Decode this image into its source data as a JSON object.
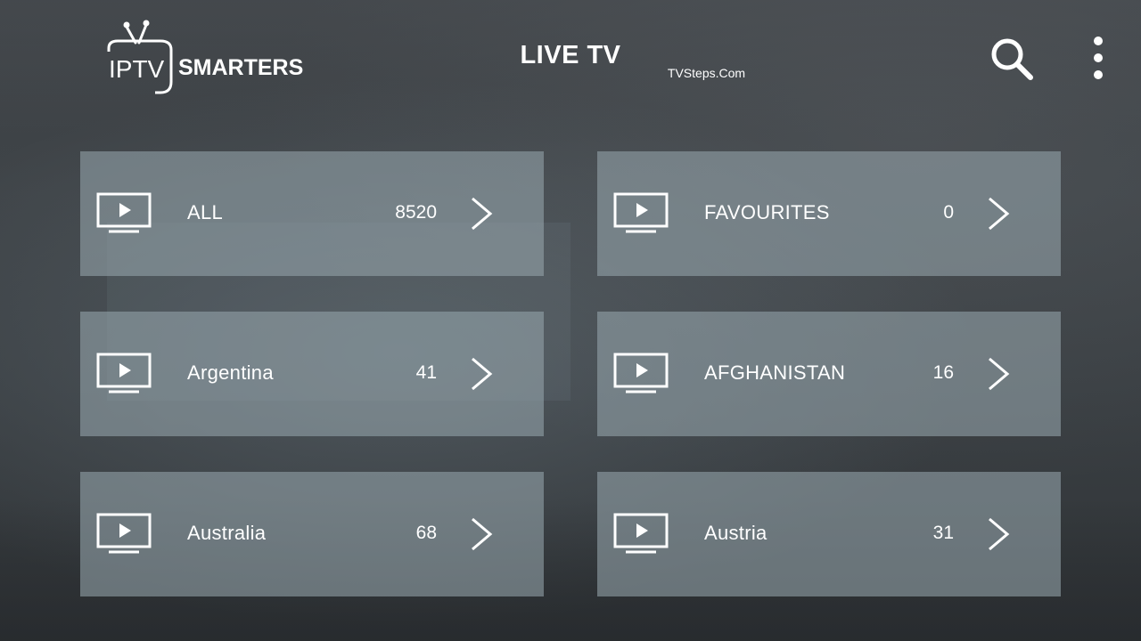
{
  "header": {
    "logo_text_left": "IPTV",
    "logo_text_right": "SMARTERS",
    "title": "LIVE TV",
    "watermark": "TVSteps.Com",
    "search_icon": "search-icon",
    "menu_icon": "more-vertical-icon"
  },
  "categories": [
    {
      "label": "ALL",
      "count": "8520",
      "icon": "tv-play-icon"
    },
    {
      "label": "FAVOURITES",
      "count": "0",
      "icon": "tv-play-icon"
    },
    {
      "label": "Argentina",
      "count": "41",
      "icon": "tv-play-icon"
    },
    {
      "label": "AFGHANISTAN",
      "count": "16",
      "icon": "tv-play-icon"
    },
    {
      "label": "Australia",
      "count": "68",
      "icon": "tv-play-icon"
    },
    {
      "label": "Austria",
      "count": "31",
      "icon": "tv-play-icon"
    }
  ],
  "colors": {
    "text": "#ffffff",
    "tile_background": "#96a5ac",
    "page_background": "#3d4145"
  }
}
